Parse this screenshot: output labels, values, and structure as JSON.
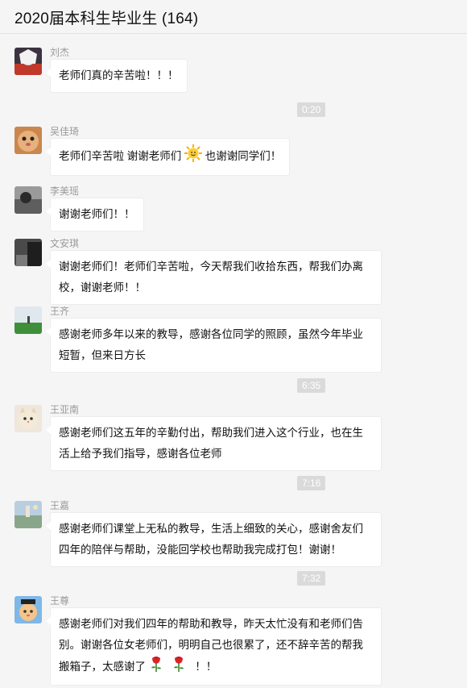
{
  "header": {
    "title": "2020届本科生毕业生 (164)"
  },
  "messages": [
    {
      "sender": "刘杰",
      "text": "老师们真的辛苦啦！！！"
    },
    {
      "time": "0:20"
    },
    {
      "sender": "吴佳琦",
      "text_a": "老师们辛苦啦 谢谢老师们",
      "emoji": "sun-face-emoji",
      "text_b": "也谢谢同学们！"
    },
    {
      "sender": "李美瑶",
      "text": "谢谢老师们！！"
    },
    {
      "sender": "文安琪",
      "lines": [
        "谢谢老师们！老师们辛苦啦，今天帮我们收拾东西，帮我们办离",
        "校，谢谢老师！！"
      ]
    },
    {
      "sender": "王齐",
      "lines": [
        "感谢老师多年以来的教导，感谢各位同学的照顾，虽然今年毕业",
        "短暂，但来日方长"
      ]
    },
    {
      "time": "6:35"
    },
    {
      "sender": "王亚南",
      "lines": [
        "感谢老师们这五年的辛勤付出，帮助我们进入这个行业，也在生",
        "活上给予我们指导，感谢各位老师"
      ]
    },
    {
      "time": "7:16"
    },
    {
      "sender": "王嘉",
      "lines": [
        "感谢老师们课堂上无私的教导，生活上细致的关心，感谢舍友们",
        "四年的陪伴与帮助，没能回学校也帮助我完成打包！谢谢！"
      ]
    },
    {
      "time": "7:32"
    },
    {
      "sender": "王尊",
      "lines": [
        "感谢老师们对我们四年的帮助和教导，昨天太忙没有和老师们告",
        "别。谢谢各位女老师们，明明自己也很累了，还不辞辛苦的帮我"
      ],
      "last_line_text": "搬箱子，太感谢了",
      "last_line_emoji": "rose-emoji",
      "last_line_tail": "！！"
    }
  ]
}
